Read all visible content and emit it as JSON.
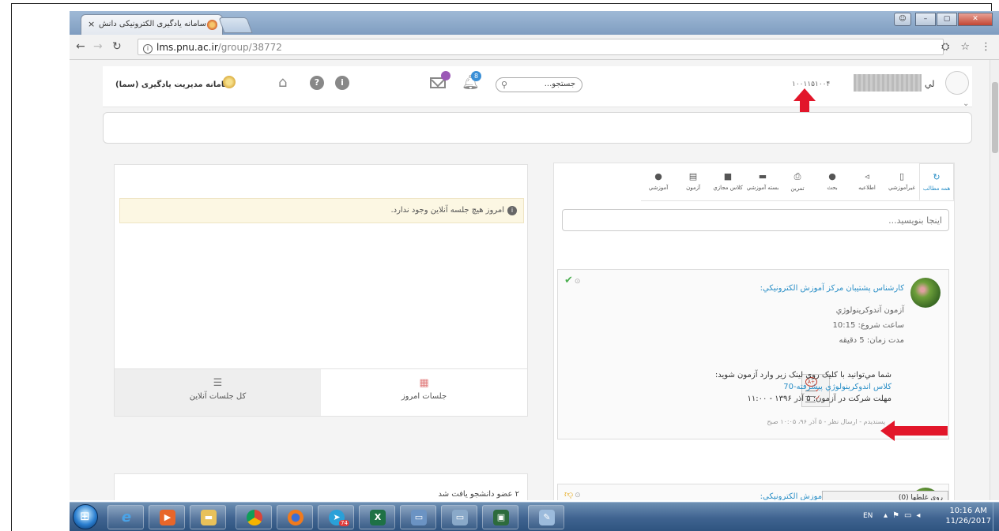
{
  "browser": {
    "tab_title": "سامانه یادگیری الکترونیکی دانش",
    "tab_close": "×",
    "url_host": "lms.pnu.ac.ir",
    "url_path": "/group/38772"
  },
  "header": {
    "logo_text": "سامانه مدیریت یادگیری (سما)",
    "mail_label": "",
    "notification_count": "8",
    "search_placeholder": "جستجو...",
    "student_id": "۱۰۰۱۱۵۱۰۰۴",
    "user_name_visible": "لي"
  },
  "left_panel": {
    "online_alert": "امروز هيچ جلسه آنلاين وجود ندارد.",
    "tabs": [
      {
        "label": "کل جلسات آنلاين"
      },
      {
        "label": "جلسات امروز"
      }
    ],
    "members_found": "۲ عضو دانشجو يافت شد"
  },
  "content_tabs": [
    {
      "label": "همه مطالب"
    },
    {
      "label": "غيرآموزشي"
    },
    {
      "label": "اطلاعيه"
    },
    {
      "label": "بحث"
    },
    {
      "label": "تمرين"
    },
    {
      "label": "بسته آموزشي"
    },
    {
      "label": "کلاس مجازي"
    },
    {
      "label": "آزمون"
    },
    {
      "label": "آموزشي"
    }
  ],
  "composer": {
    "placeholder": "اينجا بنويسيد..."
  },
  "post": {
    "author": "کارشناس پشتيبان مرکز آموزش الکترونيکي:",
    "title": "آزمون آندوکرينولوژي",
    "start_time": "ساعت شروع: 10:15",
    "duration": "مدت زمان: 5 دقيقه",
    "instruction": "شما مي‌توانيد با کليک روي لينک زير وارد آزمون شويد:",
    "class_link": "کلاس اندوکرينولوژي پيشرفته-70",
    "deadline": "مهلت شرکت در آزمون: ۵ آذر ۱۳۹۶ - ۱۱:۰۰",
    "meta": "پسنديدم - ارسال نظر - ۵ آذر ۹۶، ۱۰:۰۵ صبح"
  },
  "post2": {
    "author": "کارشناس پشتيبان مرکز آموزش الکترونيکي:"
  },
  "language_bar": "روی غلطها (0)",
  "taskbar": {
    "lang": "EN",
    "time": "10:16 AM",
    "date": "11/26/2017",
    "telegram_badge": "74"
  }
}
